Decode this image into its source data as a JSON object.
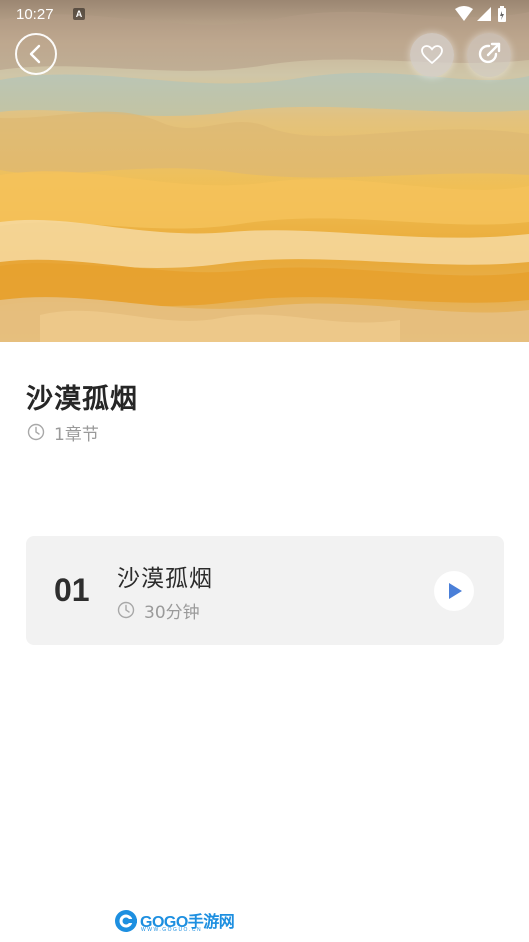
{
  "status_bar": {
    "time": "10:27",
    "notification_badge": "A",
    "icons": [
      "wifi-icon",
      "signal-icon",
      "battery-icon"
    ]
  },
  "header": {
    "back_icon": "chevron-left-icon",
    "favorite_icon": "heart-icon",
    "share_icon": "share-icon"
  },
  "album": {
    "title": "沙漠孤烟",
    "chapter_count": "1章节",
    "meta_icon": "clock-icon"
  },
  "tracks": [
    {
      "number": "01",
      "title": "沙漠孤烟",
      "duration": "30分钟",
      "play_icon": "play-icon"
    }
  ],
  "watermark": {
    "brand": "GOGO手游网",
    "url": "WWW.GOGUO.CN"
  },
  "colors": {
    "accent": "#4a7fd8",
    "card_background": "#f2f2f2",
    "secondary_text": "#9a9a9a",
    "watermark": "#1d8fe0"
  }
}
